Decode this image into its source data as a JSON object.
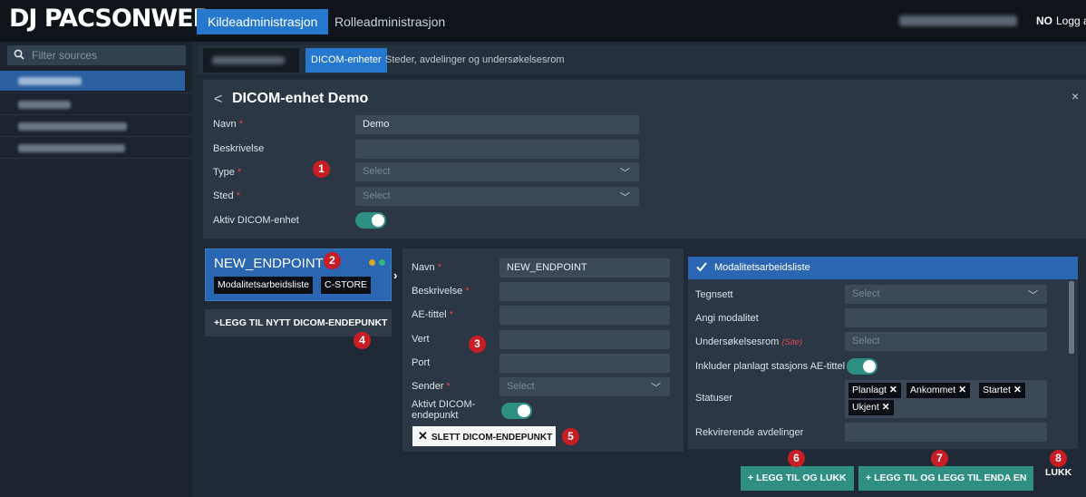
{
  "app": {
    "logo_a": "DJ",
    "logo_b": "PACSONWEB",
    "tabs": [
      "Kildeadministrasjon",
      "Rolleadministrasjon"
    ],
    "lang": "NO",
    "logout": "Logg a"
  },
  "sidebar": {
    "filter_placeholder": "Filter sources"
  },
  "subtabs": [
    "DICOM-enheter",
    "Steder, avdelinger og undersøkelsesrom"
  ],
  "unit": {
    "back": "<",
    "title": "DICOM-enhet Demo",
    "close": "×",
    "fields": {
      "name_label": "Navn",
      "name_value": "Demo",
      "desc_label": "Beskrivelse",
      "type_label": "Type",
      "type_placeholder": "Select",
      "place_label": "Sted",
      "place_placeholder": "Select",
      "active_label": "Aktiv DICOM-enhet"
    }
  },
  "endpoint_card": {
    "title": "NEW_ENDPOINT",
    "tags": [
      "Modalitetsarbeidsliste",
      "C-STORE"
    ],
    "add_label": "+LEGG TIL NYTT DICOM-ENDEPUNKT"
  },
  "endpoint_form": {
    "name_label": "Navn",
    "name_value": "NEW_ENDPOINT",
    "desc_label": "Beskrivelse",
    "ae_label": "AE-tittel",
    "host_label": "Vert",
    "port_label": "Port",
    "sender_label": "Sender",
    "sender_placeholder": "Select",
    "active_label_1": "Aktivt DICOM-",
    "active_label_2": "endepunkt",
    "delete_label": "SLETT DICOM-ENDEPUNKT"
  },
  "worklist": {
    "title": "Modalitetsarbeidsliste",
    "charset_label": "Tegnsett",
    "charset_placeholder": "Select",
    "modality_label": "Angi modalitet",
    "room_label": "Undersøkelsesrom",
    "room_site": "(Site)",
    "room_placeholder": "Select",
    "include_ae_label": "Inkluder planlagt stasjons AE-tittel",
    "status_label": "Statuser",
    "statuses": [
      "Planlagt",
      "Ankommet",
      "Startet",
      "Ukjent"
    ],
    "requesting_label": "Rekvirerende avdelinger"
  },
  "footer": {
    "add_close": "LEGG TIL OG LUKK",
    "add_another": "LEGG TIL OG LEGG TIL ENDA EN",
    "close": "LUKK"
  },
  "badges": [
    "1",
    "2",
    "3",
    "4",
    "5",
    "6",
    "7",
    "8"
  ],
  "colors": {
    "accent_blue": "#2678cf",
    "teal": "#2f8f83",
    "badge_red": "#c81d25",
    "required_red": "#e0474c"
  }
}
